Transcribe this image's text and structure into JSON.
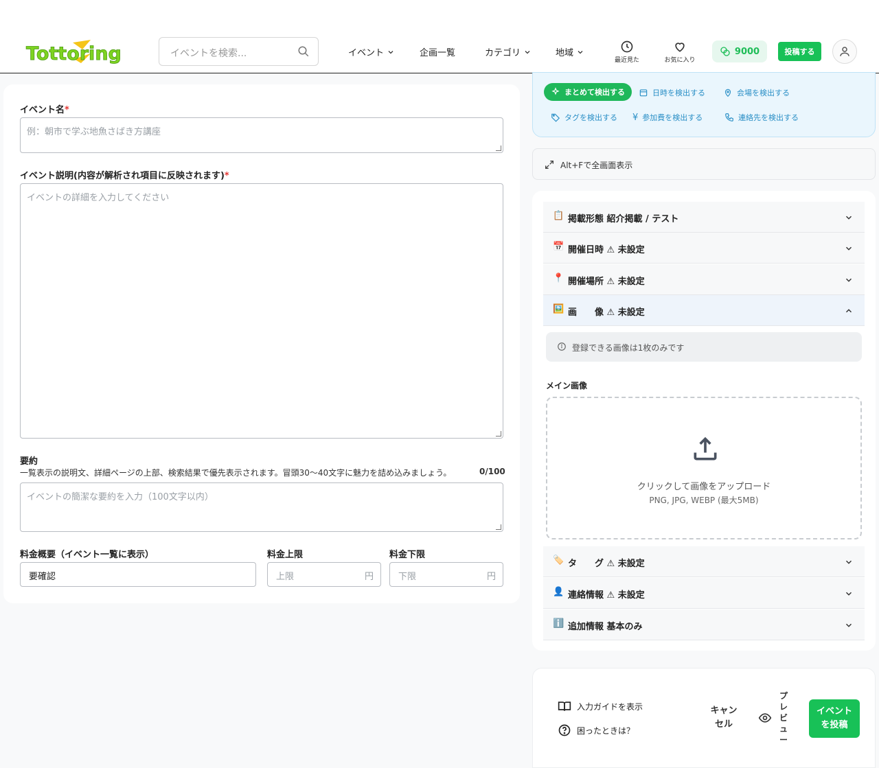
{
  "header": {
    "logo_text": "Tottoring",
    "search_placeholder": "イベントを検索...",
    "nav": [
      {
        "label": "イベント"
      },
      {
        "label": "企画一覧"
      },
      {
        "label": "カテゴリ"
      },
      {
        "label": "地域"
      }
    ],
    "recent_label": "最近見た",
    "favorites_label": "お気に入り",
    "points": "9000",
    "post_label": "投稿する"
  },
  "form": {
    "event_name_label": "イベント名",
    "event_name_placeholder": "例：朝市で学ぶ地魚さばき方講座",
    "description_label": "イベント説明(内容が解析され項目に反映されます)",
    "description_placeholder": "イベントの詳細を入力してください",
    "summary_label": "要約",
    "summary_help": "一覧表示の説明文、詳細ページの上部、検索結果で優先表示されます。冒頭30〜40文字に魅力を詰め込みましょう。",
    "summary_count": "0/100",
    "summary_placeholder": "イベントの簡潔な要約を入力（100文字以内）",
    "fee_summary_label": "料金概要（イベント一覧に表示）",
    "fee_summary_value": "要確認",
    "fee_max_label": "料金上限",
    "fee_max_placeholder": "上限",
    "fee_min_label": "料金下限",
    "fee_min_placeholder": "下限",
    "yen": "円",
    "required_mark": "*"
  },
  "detect": {
    "all": "まとめて検出する",
    "datetime": "日時を検出する",
    "venue": "会場を検出する",
    "tags": "タグを検出する",
    "fee": "参加費を検出する",
    "contact": "連絡先を検出する"
  },
  "fullscreen_label": "Alt+Fで全画面表示",
  "accordion": [
    {
      "emoji": "📋",
      "title": "掲載形態  紹介掲載 / テスト"
    },
    {
      "emoji": "📅",
      "title": "開催日時  ⚠ 未設定"
    },
    {
      "emoji": "📍",
      "title": "開催場所  ⚠ 未設定"
    },
    {
      "emoji": "🖼️",
      "title": "画　　像  ⚠ 未設定"
    },
    {
      "emoji": "🏷️",
      "title": "タ　　グ  ⚠ 未設定"
    },
    {
      "emoji": "👤",
      "title": "連絡情報  ⚠ 未設定"
    },
    {
      "emoji": "ℹ️",
      "title": "追加情報  基本のみ"
    }
  ],
  "image_section": {
    "notice": "登録できる画像は1枚のみです",
    "main_image_label": "メイン画像",
    "upload_text": "クリックして画像をアップロード",
    "upload_formats": "PNG, JPG, WEBP (最大5MB)"
  },
  "footer": {
    "guide": "入力ガイドを表示",
    "help": "困ったときは？",
    "cancel": "キャンセル",
    "preview": "プレビュー",
    "submit": "イベントを投稿"
  },
  "colors": {
    "brand_green": "#18c157",
    "logo_green": "#7ed321",
    "logo_yellow": "#f5c518",
    "link_blue": "#2a8fc6"
  }
}
